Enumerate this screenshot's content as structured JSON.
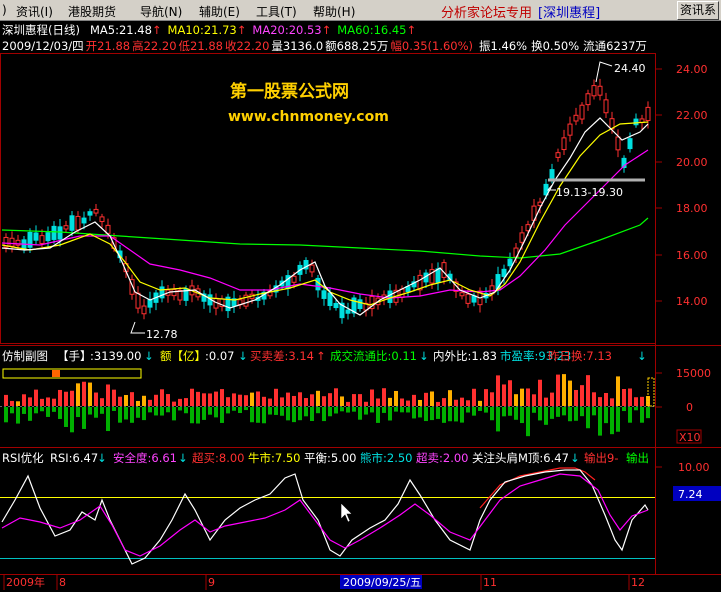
{
  "menu": {
    "items": [
      "资讯(I)",
      "港股期货",
      "导航(N)",
      "辅助(E)",
      "工具(T)",
      "帮助(H)"
    ],
    "brand": "分析家论坛专用",
    "stock_tag": "[深圳惠程]",
    "right_button": "资讯系"
  },
  "main": {
    "ma_line": {
      "title": "深圳惠程(日线)",
      "ma5": "MA5:21.48",
      "ma10": "MA10:21.73",
      "ma20": "MA20:20.53",
      "ma60": "MA60:16.45"
    },
    "quote_line": {
      "date": "2009/12/03/四",
      "open": "开21.88",
      "high": "高22.20",
      "low": "低21.88",
      "close": "收22.20",
      "volume": "量3136.0",
      "amount": "额688.25万",
      "change": "幅0.35(1.60%)",
      "amplitude": "振1.46%",
      "turnover": "换0.50%",
      "float": "流通6237万"
    },
    "watermark": {
      "title": "第一股票公式网",
      "url": "www.chnmoney.com"
    },
    "annotations": {
      "high": "24.40",
      "low": "12.78",
      "support": "19.13-19.30"
    },
    "price_axis": [
      "24.00",
      "22.00",
      "20.00",
      "18.00",
      "16.00",
      "14.00"
    ]
  },
  "volume_panel": {
    "title": "仿制副图",
    "unit": "【手】",
    "volume_value": ":3139.00",
    "amount_label": "额【亿】",
    "amount_value": ":0.07",
    "buy_sell": "买卖差:3.14",
    "ratio": "成交流通比:0.11",
    "inout": "内外比:1.83",
    "pe": "市盈率:93.23",
    "turnover": "昨日换:7.13",
    "axis": [
      "15000",
      "0"
    ],
    "multiplier": "X10"
  },
  "rsi_panel": {
    "title": "RSI优化",
    "rsi": "RSI:6.47",
    "safety": "安全度:6.61",
    "overbought": "超买:8.00",
    "bull": "牛市:7.50",
    "balance": "平衡:5.00",
    "bear": "熊市:2.50",
    "oversold": "超卖:2.00",
    "signal": "关注头肩M顶:6.47",
    "output": "输出9-",
    "output2": "输出",
    "axis_top": "10.00",
    "axis_value": "7.24"
  },
  "date_axis": {
    "year": "2009年",
    "m8": "8",
    "m9": "9",
    "cursor_date": "2009/09/25/五",
    "m11": "11",
    "m12": "12"
  },
  "colors": {
    "up": "#ff3030",
    "down": "#00e0e0",
    "ma5": "#ffffff",
    "ma10": "#ffff00",
    "ma20": "#ff00ff",
    "ma60": "#00ff00",
    "brand": "#c00000"
  }
}
